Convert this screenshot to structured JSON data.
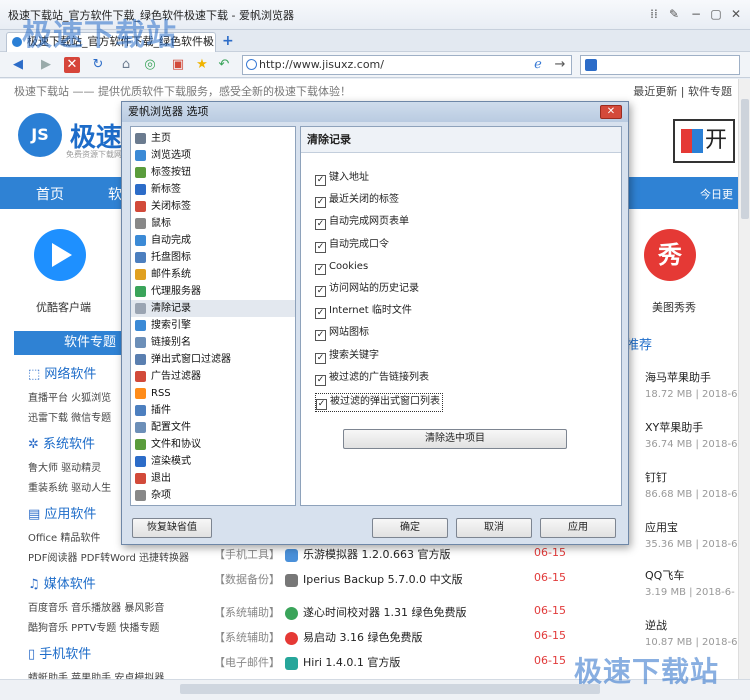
{
  "window": {
    "title": "极速下载站_官方软件下载_绿色软件极速下载 - 爱帆浏览器",
    "tab_label": "极速下载站_官方软件下载_绿色软件极...",
    "url": "http://www.jisuxz.com/"
  },
  "page": {
    "slogan": "极速下载站 —— 提供优质软件下载服务，感受全新的极速下载体验！",
    "toplinks": "最近更新 | 软件专题",
    "logo_badge": "JS",
    "logo_name": "极速下",
    "logo_sub": "免费资源下载网站",
    "nav": {
      "home": "首页",
      "soft": "软",
      "today": "今日更"
    },
    "apps": [
      {
        "label": "优酷客户端",
        "color": "#1e90ff"
      },
      {
        "label": "美图秀秀",
        "color": "#e53935"
      }
    ],
    "section_bar": "软件专题",
    "categories": [
      {
        "name": "网络软件",
        "links": "直播平台 火狐浏览"
      },
      {
        "name": "",
        "links": "迅雷下载 微信专题"
      },
      {
        "name": "系统软件",
        "links": "鲁大师 驱动精灵"
      },
      {
        "name": "",
        "links": "重装系统 驱动人生"
      },
      {
        "name": "应用软件",
        "links": "Office 精品软件"
      },
      {
        "name": "",
        "links": "PDF阅读器 PDF转Word 迅捷转换器"
      },
      {
        "name": "媒体软件",
        "links": "百度音乐 音乐播放器 暴风影音"
      },
      {
        "name": "",
        "links": "酷狗音乐 PPTV专题 快播专题"
      },
      {
        "name": "手机软件",
        "links": "蜻蜓助手 苹果助手 安卓模拟器"
      }
    ],
    "recommend_label": "推荐",
    "right_list": [
      {
        "name": "海马苹果助手",
        "meta": "18.72 MB | 2018-6"
      },
      {
        "name": "XY苹果助手",
        "meta": "36.74 MB | 2018-6"
      },
      {
        "name": "钉钉",
        "meta": "86.68 MB | 2018-6"
      },
      {
        "name": "应用宝",
        "meta": "35.36 MB | 2018-6"
      },
      {
        "name": "QQ飞车",
        "meta": "3.19 MB | 2018-6-"
      },
      {
        "name": "逆战",
        "meta": "10.87 MB | 2018-6"
      }
    ],
    "rows": [
      {
        "tag": "【手机工具】",
        "name": "乐游模拟器 1.2.0.663 官方版",
        "date": "06-15"
      },
      {
        "tag": "【数据备份】",
        "name": "Iperius Backup 5.7.0.0 中文版",
        "date": "06-15"
      },
      {
        "tag": "【系统辅助】",
        "name": "遂心时间校对器 1.31 绿色免费版",
        "date": "06-15"
      },
      {
        "tag": "【系统辅助】",
        "name": "易启动 3.16 绿色免费版",
        "date": "06-15"
      },
      {
        "tag": "【电子邮件】",
        "name": "Hiri 1.4.0.1 官方版",
        "date": "06-15"
      }
    ],
    "watermark": "极速下载站"
  },
  "dialog": {
    "title": "爱帆浏览器 选项",
    "close_glyph": "✕",
    "tree": [
      {
        "label": "主页",
        "color": "#6b7b8f"
      },
      {
        "label": "浏览选项",
        "color": "#3b8ad6"
      },
      {
        "label": "标签按钮",
        "color": "#5a9c3c"
      },
      {
        "label": "新标签",
        "color": "#2c6cc8"
      },
      {
        "label": "关闭标签",
        "color": "#d24a3a"
      },
      {
        "label": "鼠标",
        "color": "#888888"
      },
      {
        "label": "自动完成",
        "color": "#3b8ad6"
      },
      {
        "label": "托盘图标",
        "color": "#4c7fbf"
      },
      {
        "label": "邮件系统",
        "color": "#e0a020"
      },
      {
        "label": "代理服务器",
        "color": "#3aa45a"
      },
      {
        "label": "清除记录",
        "color": "#9aa4b2"
      },
      {
        "label": "搜索引擎",
        "color": "#3b8ad6"
      },
      {
        "label": "链接别名",
        "color": "#6c8fb8"
      },
      {
        "label": "弹出式窗口过滤器",
        "color": "#5a7fb0"
      },
      {
        "label": "广告过滤器",
        "color": "#d24a3a"
      },
      {
        "label": "RSS",
        "color": "#ff8c1a"
      },
      {
        "label": "插件",
        "color": "#4c7fbf"
      },
      {
        "label": "配置文件",
        "color": "#6c8fb8"
      },
      {
        "label": "文件和协议",
        "color": "#5a9c3c"
      },
      {
        "label": "渲染模式",
        "color": "#2c6cc8"
      },
      {
        "label": "退出",
        "color": "#d24a3a"
      },
      {
        "label": "杂项",
        "color": "#888888"
      }
    ],
    "selected_index": 10,
    "panel_title": "清除记录",
    "checkboxes": [
      {
        "label": "键入地址",
        "checked": true
      },
      {
        "label": "最近关闭的标签",
        "checked": true
      },
      {
        "label": "自动完成网页表单",
        "checked": true
      },
      {
        "label": "自动完成口令",
        "checked": true
      },
      {
        "label": "Cookies",
        "checked": true
      },
      {
        "label": "访问网站的历史记录",
        "checked": true
      },
      {
        "label": "Internet 临时文件",
        "checked": true
      },
      {
        "label": "网站图标",
        "checked": true
      },
      {
        "label": "搜索关键字",
        "checked": true
      },
      {
        "label": "被过滤的广告链接列表",
        "checked": true
      },
      {
        "label": "被过滤的弹出式窗口列表",
        "checked": true
      }
    ],
    "clear_button": "清除选中项目",
    "restore_defaults": "恢复缺省值",
    "ok": "确定",
    "cancel": "取消",
    "apply": "应用"
  }
}
